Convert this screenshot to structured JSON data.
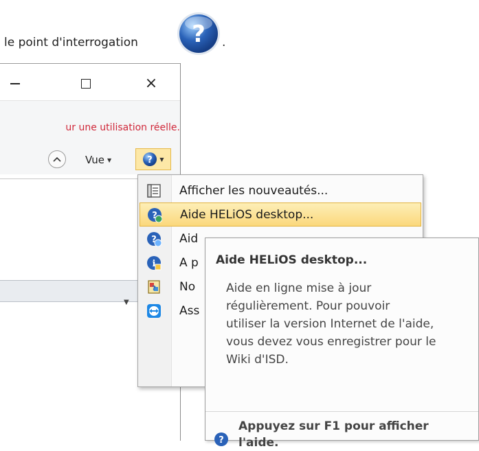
{
  "intro": {
    "text": "le point d'interrogation",
    "period": ".",
    "big_icon": "help-question-icon"
  },
  "window": {
    "warning": "ur une utilisation réelle.",
    "vue_label": "Vue",
    "controls": {
      "minimize": "minimize-icon",
      "maximize": "maximize-icon",
      "close": "×"
    }
  },
  "menu": {
    "items": [
      {
        "label": "Afficher les nouveautés...",
        "icon": "list-document-icon"
      },
      {
        "label": "Aide HELiOS desktop...",
        "icon": "help-globe-icon"
      },
      {
        "label": "Aid",
        "icon": "help-globe-icon"
      },
      {
        "label": "A p",
        "icon": "info-icon"
      },
      {
        "label": "No",
        "icon": "notes-icon"
      },
      {
        "label": "Ass",
        "icon": "teamviewer-icon"
      }
    ]
  },
  "tooltip": {
    "title": "Aide HELiOS desktop...",
    "body": [
      "Aide en ligne mise à jour",
      "régulièrement. Pour pouvoir",
      "utiliser la version Internet de l'aide,",
      "vous devez vous enregistrer pour le",
      "Wiki d'ISD."
    ],
    "footer": [
      "Appuyez sur F1 pour afficher",
      "l'aide."
    ]
  },
  "colors": {
    "warning": "#d0283a",
    "highlight": "#fbd87c",
    "help_blue": "#2a62b8"
  }
}
